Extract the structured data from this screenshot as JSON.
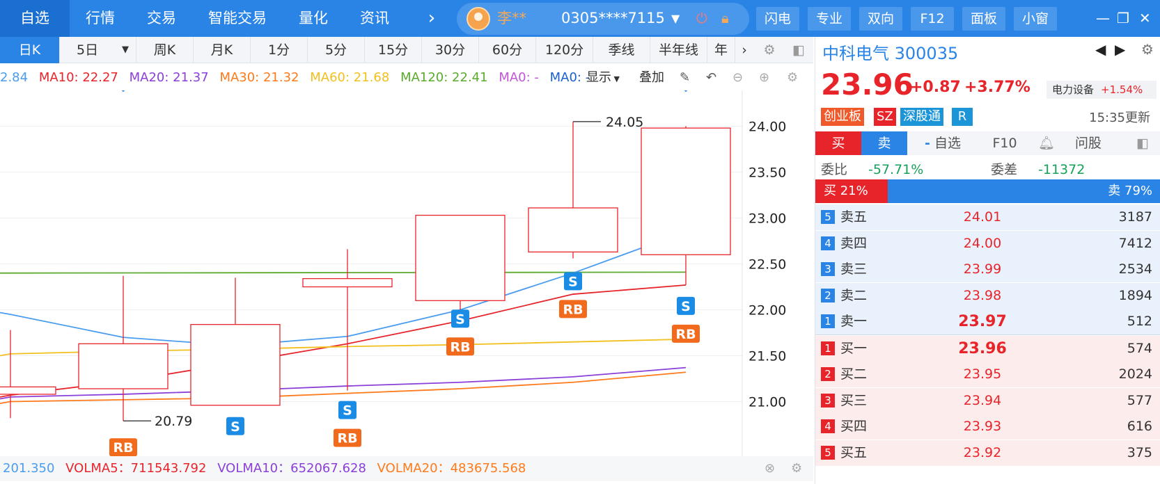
{
  "nav": {
    "items": [
      "自选",
      "行情",
      "交易",
      "智能交易",
      "量化",
      "资讯"
    ],
    "more": "›",
    "user_name": "李**",
    "account": "0305****7115",
    "buttons": [
      "闪电",
      "专业",
      "双向",
      "F12",
      "面板",
      "小窗"
    ],
    "win_controls": [
      "—",
      "❐",
      "✕"
    ]
  },
  "periods": [
    "日K",
    "5日",
    "周K",
    "月K",
    "1分",
    "5分",
    "15分",
    "30分",
    "60分",
    "120分",
    "季线",
    "半年线",
    "年"
  ],
  "ma": {
    "ma5": "2.84",
    "ma10": "MA10: 22.27",
    "ma20": "MA20: 21.37",
    "ma30": "MA30: 21.32",
    "ma60": "MA60: 21.68",
    "ma120": "MA120: 22.41",
    "ma0a": "MA0: -",
    "ma0b": "MA0: -",
    "show": "显示",
    "overlay": "叠加"
  },
  "chart": {
    "y_ticks": [
      "24.00",
      "23.50",
      "23.00",
      "22.50",
      "22.00",
      "21.50",
      "21.00"
    ],
    "high_label": "24.05",
    "low_label": "20.79",
    "signal_s": "S",
    "signal_rb": "RB"
  },
  "vol": {
    "v0": "201.350",
    "v5": "VOLMA5：711543.792",
    "v10": "VOLMA10：652067.628",
    "v20": "VOLMA20：483675.568"
  },
  "quote": {
    "name": "中科电气 300035",
    "price": "23.96",
    "change": "+0.87",
    "change_pct": "+3.77%",
    "sector": "电力设备",
    "sector_pct": "+1.54%",
    "tags": [
      "创业板",
      "SZ",
      "深股通",
      "R"
    ],
    "updated": "15:35更新",
    "buy": "买",
    "sell": "卖",
    "watch": "自选",
    "f10": "F10",
    "ask": "问股",
    "weibi_label": "委比",
    "weibi": "-57.71%",
    "weicha_label": "委差",
    "weicha": "-11372",
    "buy_pct": "买 21%",
    "sell_pct": "卖 79%",
    "buy_ratio": 0.21
  },
  "asks": [
    {
      "n": "5",
      "label": "卖五",
      "price": "24.01",
      "vol": "3187"
    },
    {
      "n": "4",
      "label": "卖四",
      "price": "24.00",
      "vol": "7412"
    },
    {
      "n": "3",
      "label": "卖三",
      "price": "23.99",
      "vol": "2534"
    },
    {
      "n": "2",
      "label": "卖二",
      "price": "23.98",
      "vol": "1894"
    },
    {
      "n": "1",
      "label": "卖一",
      "price": "23.97",
      "vol": "512"
    }
  ],
  "bids": [
    {
      "n": "1",
      "label": "买一",
      "price": "23.96",
      "vol": "574"
    },
    {
      "n": "2",
      "label": "买二",
      "price": "23.95",
      "vol": "2024"
    },
    {
      "n": "3",
      "label": "买三",
      "price": "23.94",
      "vol": "577"
    },
    {
      "n": "4",
      "label": "买四",
      "price": "23.93",
      "vol": "616"
    },
    {
      "n": "5",
      "label": "买五",
      "price": "23.92",
      "vol": "375"
    }
  ],
  "chart_data": {
    "type": "candlestick",
    "ylim": [
      20.8,
      24.2
    ],
    "candles": [
      {
        "open": 21.16,
        "close": 21.08,
        "high": 21.78,
        "low": 20.82
      },
      {
        "open": 21.14,
        "close": 21.63,
        "high": 22.37,
        "low": 20.79
      },
      {
        "open": 20.96,
        "close": 21.84,
        "high": 22.35,
        "low": 20.96
      },
      {
        "open": 22.25,
        "close": 22.34,
        "high": 22.66,
        "low": 21.12
      },
      {
        "open": 22.1,
        "close": 23.03,
        "high": 23.03,
        "low": 21.83
      },
      {
        "open": 22.63,
        "close": 23.11,
        "high": 24.05,
        "low": 22.56
      },
      {
        "open": 22.6,
        "close": 23.98,
        "high": 24.0,
        "low": 22.27
      }
    ],
    "series": [
      {
        "name": "MA10",
        "color": "#e8242b",
        "values": [
          21.07,
          21.22,
          21.42,
          21.63,
          21.88,
          22.17,
          22.27
        ]
      },
      {
        "name": "MA20",
        "color": "#8b3fd9",
        "values": [
          21.05,
          21.08,
          21.12,
          21.17,
          21.21,
          21.27,
          21.37
        ]
      },
      {
        "name": "MA30",
        "color": "#ff7a1a",
        "values": [
          21.0,
          21.02,
          21.04,
          21.09,
          21.14,
          21.21,
          21.32
        ]
      },
      {
        "name": "MA60",
        "color": "#f2c01e",
        "values": [
          21.52,
          21.55,
          21.57,
          21.6,
          21.62,
          21.65,
          21.68
        ]
      },
      {
        "name": "MA120",
        "color": "#5aab2c",
        "values": [
          22.4,
          22.4,
          22.4,
          22.4,
          22.4,
          22.41,
          22.41
        ]
      },
      {
        "name": "MA5",
        "color": "#4a9cf0",
        "values": [
          21.95,
          21.7,
          21.61,
          21.71,
          22.0,
          22.4,
          22.85
        ]
      }
    ],
    "signals": [
      {
        "candle": 1,
        "labels": [
          "RB"
        ]
      },
      {
        "candle": 2,
        "labels": [
          "S"
        ]
      },
      {
        "candle": 3,
        "labels": [
          "S",
          "RB"
        ]
      },
      {
        "candle": 4,
        "labels": [
          "S",
          "RB"
        ]
      },
      {
        "candle": 5,
        "labels": [
          "S",
          "RB"
        ]
      },
      {
        "candle": 6,
        "labels": [
          "S",
          "RB"
        ]
      }
    ]
  }
}
